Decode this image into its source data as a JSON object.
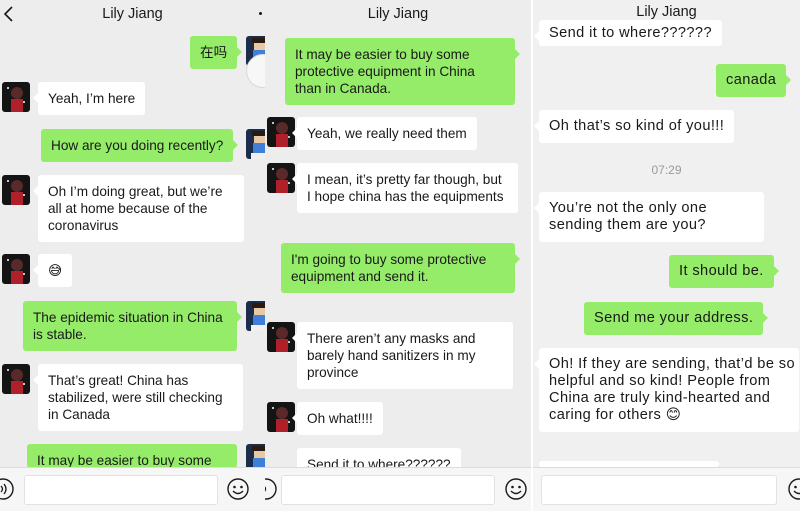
{
  "contact_name": "Lily Jiang",
  "colors": {
    "sent_bubble": "#95ec69",
    "received_bubble": "#ffffff",
    "chat_bg": "#ededed",
    "timestamp": "#9a9a9a"
  },
  "panel1": {
    "messages": [
      {
        "side": "out",
        "text": "在吗"
      },
      {
        "side": "in",
        "text": "Yeah, I’m here"
      },
      {
        "side": "out",
        "text": "How are you doing recently?"
      },
      {
        "side": "in",
        "text": "Oh I’m doing great, but we’re all at home because of the coronavirus"
      },
      {
        "side": "in",
        "text": "😅"
      },
      {
        "side": "out",
        "text": "The epidemic situation in China is stable."
      },
      {
        "side": "in",
        "text": "That’s great! China has stabilized, were still checking in Canada"
      },
      {
        "side": "out",
        "text": "It may be easier to buy some"
      }
    ]
  },
  "panel2": {
    "messages": [
      {
        "side": "out",
        "text": "It may be easier to buy some protective equipment in China than in Canada."
      },
      {
        "side": "in",
        "text": "Yeah, we really need them"
      },
      {
        "side": "in",
        "text": "I mean, it’s pretty far though, but I hope china has the equipments"
      },
      {
        "side": "out",
        "text": "I'm going to buy some protective equipment and send it."
      },
      {
        "side": "in",
        "text": "There aren’t any masks and barely hand sanitizers in my province"
      },
      {
        "side": "in",
        "text": "Oh what!!!!"
      },
      {
        "side": "in",
        "text": "Send it to where??????"
      }
    ]
  },
  "panel3": {
    "messages": [
      {
        "side": "in",
        "text": "Send it to where??????"
      },
      {
        "side": "out",
        "text": "canada"
      },
      {
        "side": "in",
        "text": "Oh that’s so kind of you!!!"
      },
      {
        "side": "in",
        "text": "You’re not the only one sending them are you?"
      },
      {
        "side": "out",
        "text": "It should be."
      },
      {
        "side": "out",
        "text": "Send me your address."
      },
      {
        "side": "in",
        "text": "Oh! If they are sending, that’d be so helpful and so kind! People from China are truly kind-hearted and caring for others 😊"
      }
    ],
    "timestamp": "07:29"
  },
  "icons": {
    "back": "chevron-left-icon",
    "more": "more-dot-icon",
    "emoji": "emoji-icon",
    "voice": "voice-icon"
  }
}
